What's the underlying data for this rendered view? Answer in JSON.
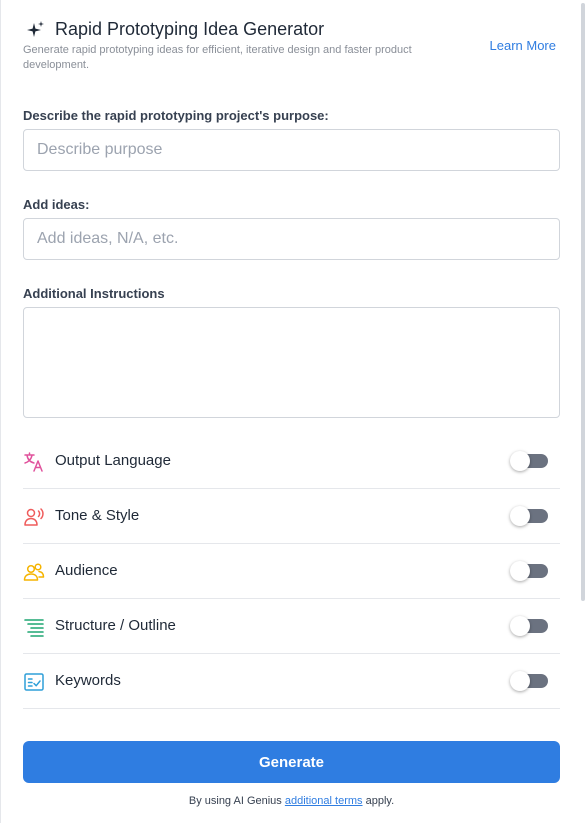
{
  "header": {
    "title": "Rapid Prototyping Idea Generator",
    "subtitle": "Generate rapid prototyping ideas for efficient, iterative design and faster product development.",
    "learn_more": "Learn More",
    "icon": "sparkle-icon"
  },
  "form": {
    "purpose": {
      "label": "Describe the rapid prototyping project's purpose:",
      "placeholder": "Describe purpose",
      "value": ""
    },
    "ideas": {
      "label": "Add ideas:",
      "placeholder": "Add ideas, N/A, etc.",
      "value": ""
    },
    "instructions": {
      "label": "Additional Instructions",
      "value": ""
    }
  },
  "options": [
    {
      "label": "Output Language",
      "icon": "translate-icon",
      "color": "#e0529c",
      "enabled": false
    },
    {
      "label": "Tone & Style",
      "icon": "voice-icon",
      "color": "#ef5b5b",
      "enabled": false
    },
    {
      "label": "Audience",
      "icon": "users-icon",
      "color": "#f5b400",
      "enabled": false
    },
    {
      "label": "Structure / Outline",
      "icon": "list-icon",
      "color": "#1ea672",
      "enabled": false
    },
    {
      "label": "Keywords",
      "icon": "checklist-icon",
      "color": "#2f9fd8",
      "enabled": false
    }
  ],
  "actions": {
    "generate": "Generate"
  },
  "footer": {
    "prefix": "By using AI Genius",
    "link": "additional terms",
    "suffix": "apply."
  },
  "colors": {
    "accent": "#2f7de1",
    "toggle_off": "#6b7280"
  }
}
